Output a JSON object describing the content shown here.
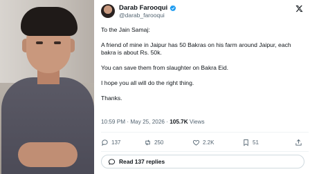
{
  "tweet": {
    "author_name": "Darab Farooqui",
    "handle": "@darab_farooqui",
    "paragraphs": [
      "To the Jain Samaj:",
      "A friend of mine in Jaipur has 50 Bakras on his farm around Jaipur, each bakra is about Rs. 50k.",
      "You can save them from slaughter on Bakra Eid.",
      "I hope you all will do the right thing.",
      "Thanks."
    ],
    "timestamp": "10:59 PM · May 25, 2026 · ",
    "views_count": "105.7K",
    "views_label": " Views"
  },
  "actions": {
    "replies": "137",
    "reposts": "250",
    "likes": "2.2K",
    "bookmarks": "51"
  },
  "read_replies_label": "Read 137 replies",
  "icons": {
    "verified": "verified-badge-icon",
    "brand": "x-logo-icon",
    "reply": "reply-icon",
    "repost": "repost-icon",
    "like": "heart-icon",
    "bookmark": "bookmark-icon",
    "share": "share-icon",
    "replies": "speech-bubble-icon"
  },
  "colors": {
    "text": "#0f1419",
    "muted": "#536471",
    "verified": "#1d9bf0",
    "border": "#cfd9de"
  }
}
